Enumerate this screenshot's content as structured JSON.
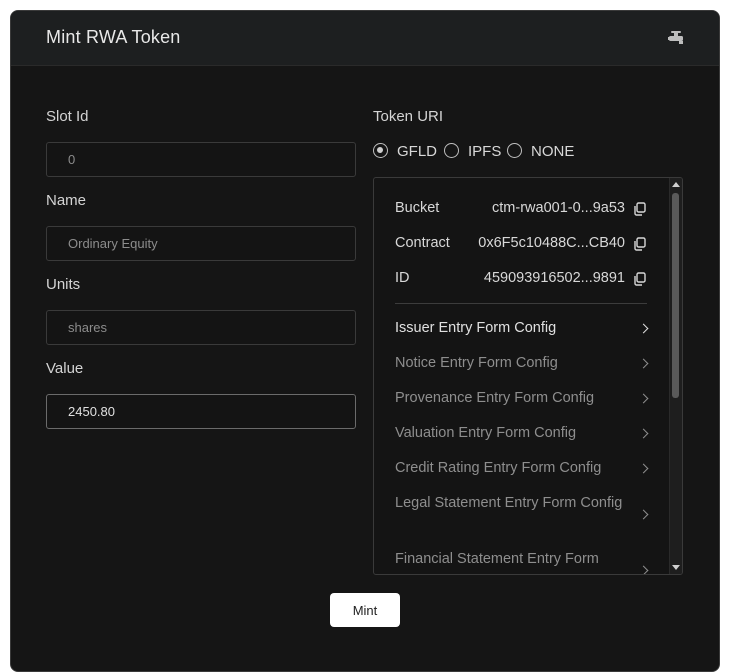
{
  "card": {
    "title": "Mint RWA Token",
    "header_icon": "faucet-icon"
  },
  "form": {
    "slot_id": {
      "label": "Slot Id",
      "value": "0"
    },
    "name": {
      "label": "Name",
      "value": "Ordinary Equity"
    },
    "units": {
      "label": "Units",
      "value": "shares"
    },
    "value": {
      "label": "Value",
      "value": "2450.80"
    }
  },
  "token_uri": {
    "label": "Token URI",
    "options": [
      "GFLD",
      "IPFS",
      "NONE"
    ],
    "selected": "GFLD"
  },
  "details": {
    "rows": [
      {
        "key": "Bucket",
        "value": "ctm-rwa001-0...9a53"
      },
      {
        "key": "Contract",
        "value": "0x6F5c10488C...CB40"
      },
      {
        "key": "ID",
        "value": "459093916502...9891"
      }
    ],
    "configs": [
      "Issuer Entry Form Config",
      "Notice Entry Form Config",
      "Provenance Entry Form Config",
      "Valuation Entry Form Config",
      "Credit Rating Entry Form Config",
      "Legal Statement Entry Form Config",
      "Financial Statement Entry Form"
    ]
  },
  "actions": {
    "mint_label": "Mint"
  },
  "colors": {
    "card_bg": "#151515",
    "header_bg": "#1d1f20",
    "button_bg": "#ffffff"
  }
}
